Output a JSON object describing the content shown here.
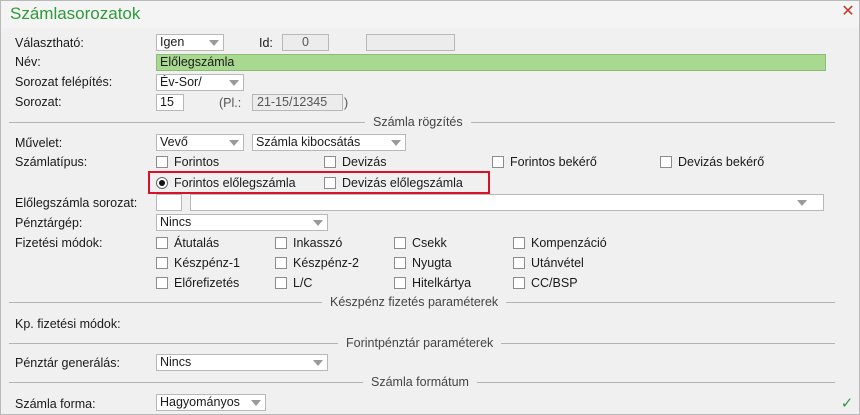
{
  "window": {
    "title": "Számlasorozatok"
  },
  "fields": {
    "valaszthato": {
      "label": "Választható:",
      "value": "Igen"
    },
    "id": {
      "label": "Id:",
      "value": "0",
      "extra": ""
    },
    "nev": {
      "label": "Név:",
      "value": "Előlegszámla"
    },
    "sorozat_felepites": {
      "label": "Sorozat felépítés:",
      "value": "Év-Sor/"
    },
    "sorozat": {
      "label": "Sorozat:",
      "value": "15",
      "hint_open": "(Pl.:",
      "hint_value": "21-15/12345",
      "hint_close": ")"
    }
  },
  "sections": {
    "szamla_rogzites": "Számla rögzítés",
    "keszpenz": "Készpénz fizetés paraméterek",
    "forintpenztar": "Forintpénztár paraméterek",
    "szamla_formatum": "Számla formátum"
  },
  "muvelet": {
    "label": "Művelet:",
    "value1": "Vevő",
    "value2": "Számla kibocsátás"
  },
  "szamlatipus": {
    "label": "Számlatípus:",
    "options": [
      "Forintos",
      "Devizás",
      "Forintos bekérő",
      "Devizás bekérő"
    ],
    "advance": [
      "Forintos előlegszámla",
      "Devizás előlegszámla"
    ],
    "selected": "Forintos előlegszámla"
  },
  "elolegszamla_sorozat": {
    "label": "Előlegszámla sorozat:",
    "value": ""
  },
  "penztargep": {
    "label": "Pénztárgép:",
    "value": "Nincs"
  },
  "fizetesi_modok": {
    "label": "Fizetési módok:",
    "options": [
      "Átutalás",
      "Inkasszó",
      "Csekk",
      "Kompenzáció",
      "Készpénz-1",
      "Készpénz-2",
      "Nyugta",
      "Utánvétel",
      "Előrefizetés",
      "L/C",
      "Hitelkártya",
      "CC/BSP"
    ]
  },
  "kp_fizetesi_modok": {
    "label": "Kp. fizetési módok:"
  },
  "penztar_generalas": {
    "label": "Pénztár generálás:",
    "value": "Nincs"
  },
  "szamla_forma": {
    "label": "Számla forma:",
    "value": "Hagyományos"
  },
  "colors": {
    "title": "#2f9a3c",
    "name_field": "#a9d890",
    "highlight": "#d9122a",
    "close": "#c0392b"
  },
  "icons": {
    "close": "close-icon",
    "ok": "check-icon"
  }
}
